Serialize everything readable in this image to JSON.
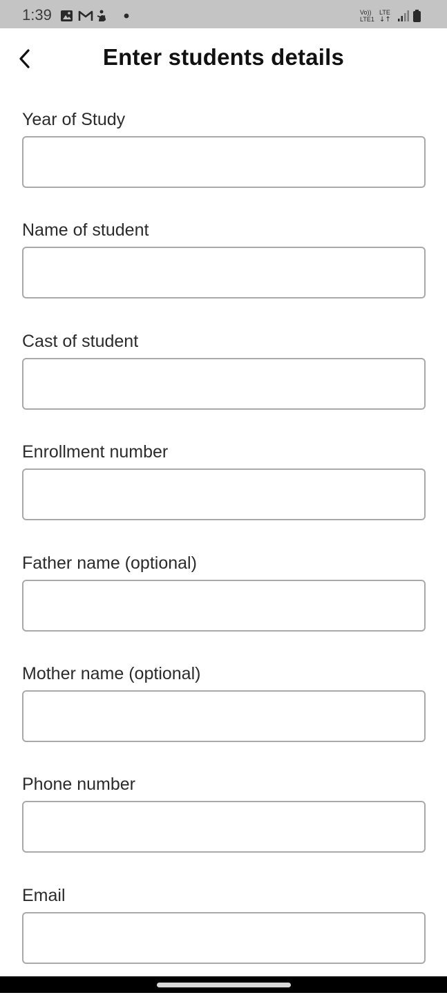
{
  "status_bar": {
    "time": "1:39",
    "left_icons": [
      "gallery-icon",
      "gmail-icon",
      "accessibility-icon",
      "notification-dot-icon"
    ],
    "right_icons": [
      "volte-lte-icon",
      "signal-icon",
      "battery-icon"
    ],
    "volte_top": "Vo))",
    "volte_bottom": "LTE1",
    "lte_label": "LTE"
  },
  "header": {
    "title": "Enter students details",
    "back_icon": "chevron-left-icon"
  },
  "form": {
    "fields": [
      {
        "label": "Year of Study",
        "value": "",
        "placeholder": ""
      },
      {
        "label": "Name of student",
        "value": "",
        "placeholder": ""
      },
      {
        "label": "Cast of student",
        "value": "",
        "placeholder": ""
      },
      {
        "label": "Enrollment number",
        "value": "",
        "placeholder": ""
      },
      {
        "label": "Father name (optional)",
        "value": "",
        "placeholder": ""
      },
      {
        "label": "Mother name (optional)",
        "value": "",
        "placeholder": ""
      },
      {
        "label": "Phone number",
        "value": "",
        "placeholder": ""
      },
      {
        "label": "Email",
        "value": "",
        "placeholder": ""
      }
    ]
  },
  "colors": {
    "status_bar_bg": "#c4c4c4",
    "input_border": "#a9a9a9",
    "nav_bar_bg": "#000000"
  }
}
